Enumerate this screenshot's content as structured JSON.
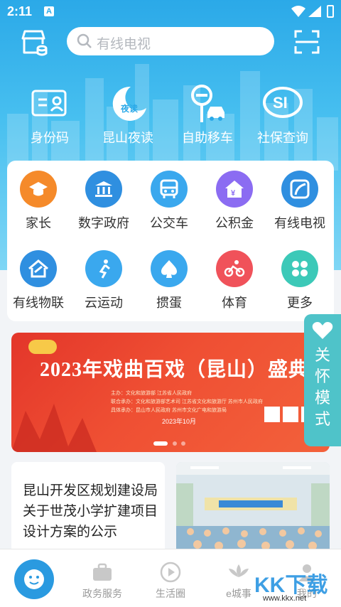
{
  "status": {
    "time": "2:11",
    "notif": "A"
  },
  "search": {
    "placeholder": "有线电视"
  },
  "quick_actions": [
    {
      "label": "身份码",
      "icon": "id-card-icon"
    },
    {
      "label": "昆山夜读",
      "icon": "moon-read-icon",
      "badge": "夜读"
    },
    {
      "label": "自助移车",
      "icon": "move-car-icon"
    },
    {
      "label": "社保查询",
      "icon": "social-security-icon"
    }
  ],
  "services": [
    {
      "label": "家长",
      "icon": "graduation-cap-icon",
      "color": "#f58a2a"
    },
    {
      "label": "数字政府",
      "icon": "government-icon",
      "color": "#2f8fe0"
    },
    {
      "label": "公交车",
      "icon": "bus-icon",
      "color": "#3aa8ee"
    },
    {
      "label": "公积金",
      "icon": "housing-fund-icon",
      "color": "#8b6cf2"
    },
    {
      "label": "有线电视",
      "icon": "cable-tv-icon",
      "color": "#2f8fe0"
    },
    {
      "label": "有线物联",
      "icon": "iot-home-icon",
      "color": "#2f8fe0"
    },
    {
      "label": "云运动",
      "icon": "sport-icon",
      "color": "#3aa8ee"
    },
    {
      "label": "掼蛋",
      "icon": "spade-icon",
      "color": "#3aa8ee"
    },
    {
      "label": "体育",
      "icon": "cycling-icon",
      "color": "#f0525a"
    },
    {
      "label": "更多",
      "icon": "more-grid-icon",
      "color": "#3cc9b8"
    }
  ],
  "banner": {
    "title": "2023年戏曲百戏（昆山）盛典",
    "host": "主办：文化和旅游部   江苏省人民政府",
    "co_host": "联合承办：文化和旅游部艺术司   江苏省文化和旅游厅   苏州市人民政府",
    "organizer": "具体承办：昆山市人民政府   苏州市文化广电和旅游局",
    "date": "2023年10月"
  },
  "care_mode": {
    "label": "关怀模式"
  },
  "news": {
    "title": "昆山开发区规划建设局关于世茂小学扩建项目设计方案的公示"
  },
  "tabs": [
    {
      "label": "",
      "icon": "home-icon"
    },
    {
      "label": "政务服务",
      "icon": "briefcase-icon"
    },
    {
      "label": "生活圈",
      "icon": "play-icon"
    },
    {
      "label": "e城事",
      "icon": "lotus-icon"
    },
    {
      "label": "我的",
      "icon": "user-icon"
    }
  ],
  "watermark": {
    "text": "KK下载",
    "site": "www.kkx.net"
  }
}
